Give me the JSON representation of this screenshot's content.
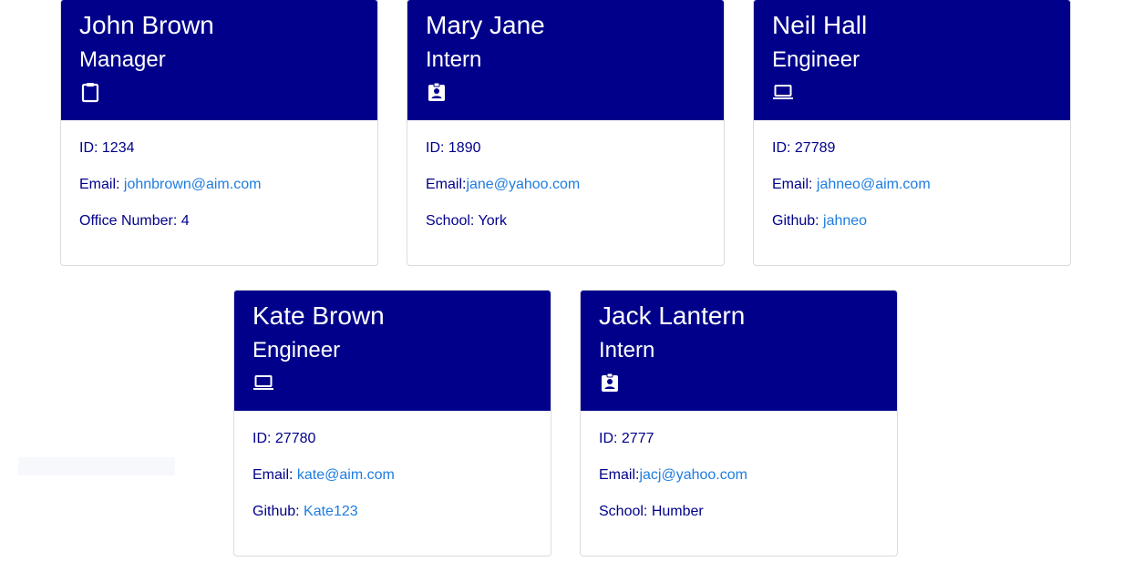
{
  "employees": [
    {
      "name": "John Brown",
      "role": "Manager",
      "icon": "clipboard-icon",
      "id_label": "ID: 1234",
      "email_prefix": "Email: ",
      "email": "johnbrown@aim.com",
      "extra_label": "Office Number: 4",
      "extra_link": ""
    },
    {
      "name": "Mary Jane",
      "role": "Intern",
      "icon": "id-badge-icon",
      "id_label": "ID: 1890",
      "email_prefix": "Email:",
      "email": "jane@yahoo.com",
      "extra_label": "School: York",
      "extra_link": ""
    },
    {
      "name": "Neil Hall",
      "role": "Engineer",
      "icon": "laptop-icon",
      "id_label": "ID: 27789",
      "email_prefix": "Email: ",
      "email": "jahneo@aim.com",
      "extra_label": "Github: ",
      "extra_link": "jahneo"
    },
    {
      "name": "Kate Brown",
      "role": "Engineer",
      "icon": "laptop-icon",
      "id_label": "ID: 27780",
      "email_prefix": "Email: ",
      "email": "kate@aim.com",
      "extra_label": "Github: ",
      "extra_link": "Kate123"
    },
    {
      "name": "Jack Lantern",
      "role": "Intern",
      "icon": "id-badge-icon",
      "id_label": "ID: 2777",
      "email_prefix": "Email:",
      "email": "jacj@yahoo.com",
      "extra_label": "School: Humber",
      "extra_link": ""
    }
  ],
  "colors": {
    "header_bg": "#00008b",
    "body_text": "#00008b",
    "link": "#1e7de0"
  }
}
